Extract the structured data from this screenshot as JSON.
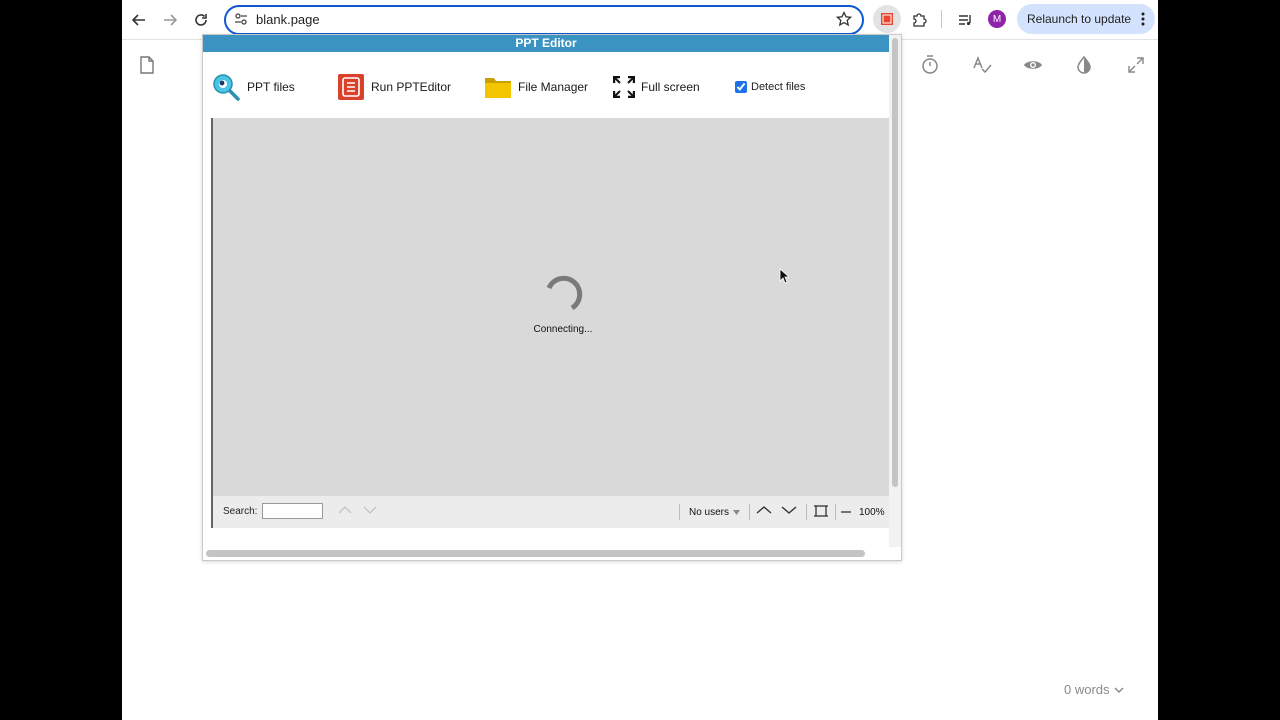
{
  "browser": {
    "url": "blank.page",
    "avatar_initial": "M",
    "relaunch_label": "Relaunch to update",
    "accent": "#0b57d0",
    "relaunch_bg": "#d3e3fd",
    "avatar_color": "#8e24aa"
  },
  "page": {
    "word_count": "0 words",
    "left_icon": "document-icon",
    "right_icons": [
      "timer-icon",
      "spellcheck-icon",
      "eye-icon",
      "contrast-icon",
      "expand-icon"
    ]
  },
  "popup": {
    "title": "PPT Editor",
    "title_bg": "#3b93c2",
    "toolbar": {
      "ppt_files": "PPT files",
      "run": "Run PPTEditor",
      "file_manager": "File Manager",
      "full_screen": "Full screen",
      "detect_files": "Detect files",
      "detect_checked": true
    },
    "status": "Connecting...",
    "bottom": {
      "search_label": "Search:",
      "search_value": "",
      "users": "No users",
      "zoom": "100%"
    }
  }
}
